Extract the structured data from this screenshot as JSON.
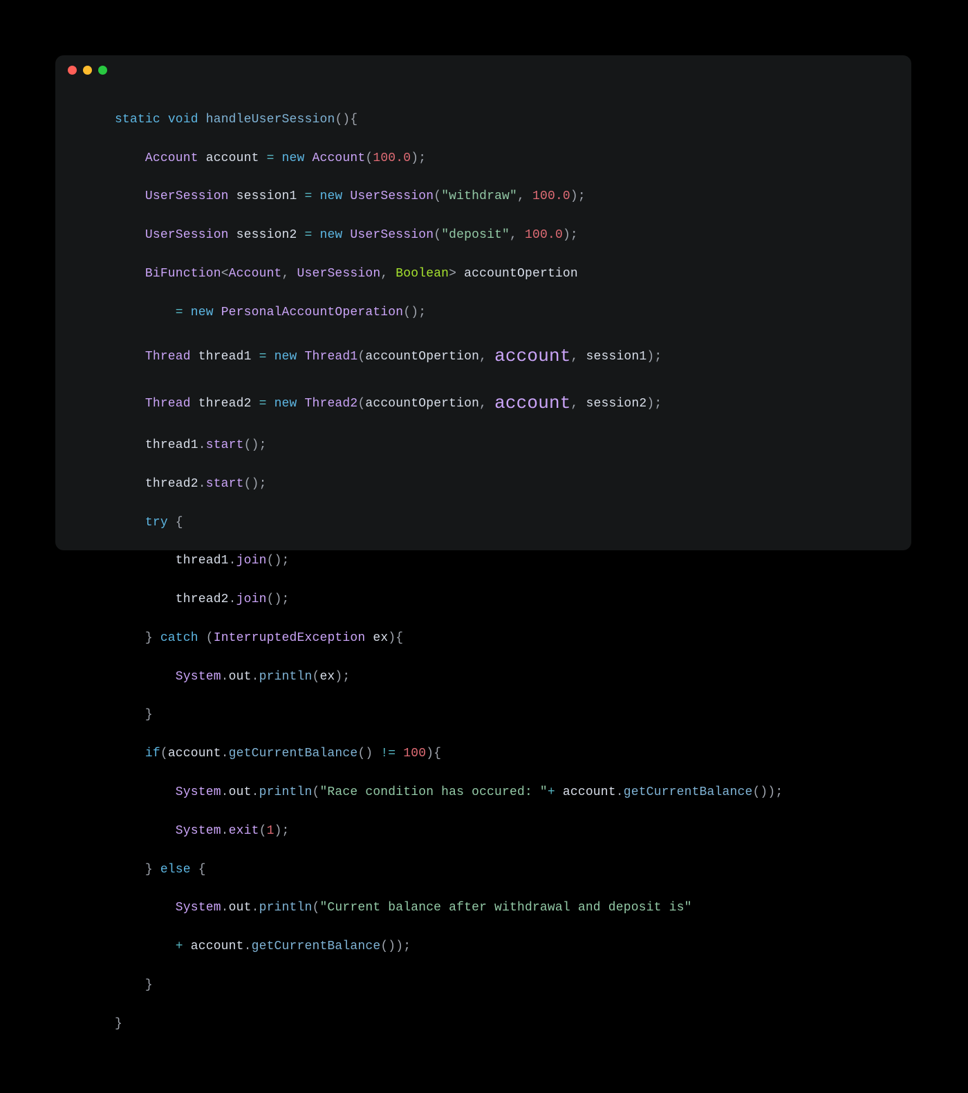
{
  "window": {
    "traffic_light_colors": {
      "close": "#ff5f57",
      "minimize": "#febc2e",
      "zoom": "#28c840"
    }
  },
  "code": {
    "t_static": "static",
    "t_void": "void",
    "t_new": "new",
    "t_try": "try",
    "t_catch": "catch",
    "t_if": "if",
    "t_else": "else",
    "fn_handleUserSession": "handleUserSession",
    "fn_println": "println",
    "fn_getCurrentBalance": "getCurrentBalance",
    "fn_start": "start",
    "fn_join": "join",
    "fn_exit": "exit",
    "type_Account": "Account",
    "type_UserSession": "UserSession",
    "type_BiFunction": "BiFunction",
    "type_Boolean": "Boolean",
    "type_PersonalAccountOperation": "PersonalAccountOperation",
    "type_Thread": "Thread",
    "type_Thread1": "Thread1",
    "type_Thread2": "Thread2",
    "type_InterruptedException": "InterruptedException",
    "type_System": "System",
    "id_account": "account",
    "id_account_em": "account",
    "id_session1": "session1",
    "id_session2": "session2",
    "id_accountOpertion": "accountOpertion",
    "id_thread1": "thread1",
    "id_thread2": "thread2",
    "id_out": "out",
    "id_ex": "ex",
    "num_100_0": "100.0",
    "num_100": "100",
    "num_1": "1",
    "str_withdraw": "\"withdraw\"",
    "str_deposit": "\"deposit\"",
    "str_race": "\"Race condition has occured: \"",
    "str_balance": "\"Current balance after withdrawal and deposit is\"",
    "op_assign": "=",
    "op_ne": " != ",
    "op_plus": "+ ",
    "p_open": "(",
    "p_close": ")",
    "p_brace_open": "{",
    "p_brace_close": "}",
    "p_semi": ";",
    "p_comma": ", ",
    "p_lt": "<",
    "p_gt": ">",
    "p_dot": "."
  }
}
